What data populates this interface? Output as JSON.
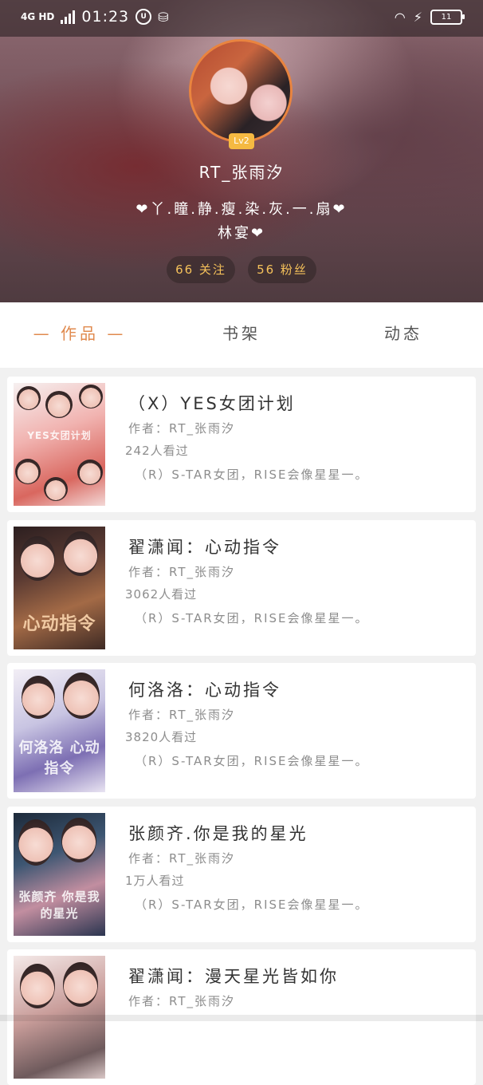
{
  "status_bar": {
    "network": "4G HD",
    "time": "01:23",
    "battery": "11"
  },
  "profile": {
    "level": "Lv2",
    "username": "RT_张雨汐",
    "bio_line1": "❤丫.瞳.静.瘦.染.灰.一.扇❤",
    "bio_line2": "林宴❤",
    "following_label": "66 关注",
    "fans_label": "56 粉丝"
  },
  "tabs": [
    {
      "label": "— 作品 —",
      "active": true
    },
    {
      "label": "书架",
      "active": false
    },
    {
      "label": "动态",
      "active": false
    }
  ],
  "books": [
    {
      "title": "（X）YES女团计划",
      "author": "作者：RT_张雨汐",
      "views": "242人看过",
      "description": "（R）S-TAR女团，RISE会像星星一。",
      "cover_text": "YES女团计划"
    },
    {
      "title": "翟潇闻：心动指令",
      "author": "作者：RT_张雨汐",
      "views": "3062人看过",
      "description": "（R）S-TAR女团，RISE会像星星一。",
      "cover_text": "心动指令"
    },
    {
      "title": "何洛洛：心动指令",
      "author": "作者：RT_张雨汐",
      "views": "3820人看过",
      "description": "（R）S-TAR女团，RISE会像星星一。",
      "cover_text": "何洛洛 心动指令"
    },
    {
      "title": "张颜齐.你是我的星光",
      "author": "作者：RT_张雨汐",
      "views": "1万人看过",
      "description": "（R）S-TAR女团，RISE会像星星一。",
      "cover_text": "张颜齐 你是我的星光"
    },
    {
      "title": "翟潇闻：漫天星光皆如你",
      "author": "作者：RT_张雨汐",
      "views": "",
      "description": "",
      "cover_text": ""
    }
  ],
  "colors": {
    "accent": "#e08a4e",
    "level_badge": "#f5b942",
    "stat_text": "#f5c15a"
  }
}
